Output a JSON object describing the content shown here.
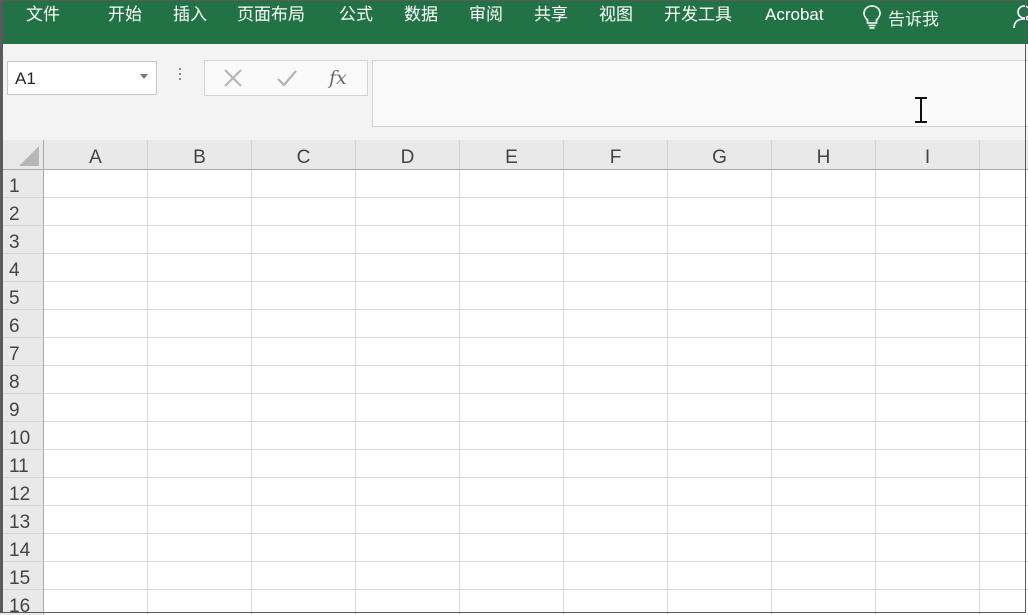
{
  "ribbon": {
    "tabs": [
      "文件",
      "开始",
      "插入",
      "页面布局",
      "公式",
      "数据",
      "审阅",
      "共享",
      "视图",
      "开发工具",
      "Acrobat"
    ],
    "tell_me": "告诉我",
    "color": "#217346"
  },
  "formula_bar": {
    "name_box_value": "A1",
    "cancel_icon": "close-icon",
    "enter_icon": "check-icon",
    "function_label": "fx",
    "formula_value": ""
  },
  "sheet": {
    "columns": [
      "A",
      "B",
      "C",
      "D",
      "E",
      "F",
      "G",
      "H",
      "I"
    ],
    "rows": [
      "1",
      "2",
      "3",
      "4",
      "5",
      "6",
      "7",
      "8",
      "9",
      "10",
      "11",
      "12",
      "13",
      "14",
      "15",
      "16"
    ]
  }
}
